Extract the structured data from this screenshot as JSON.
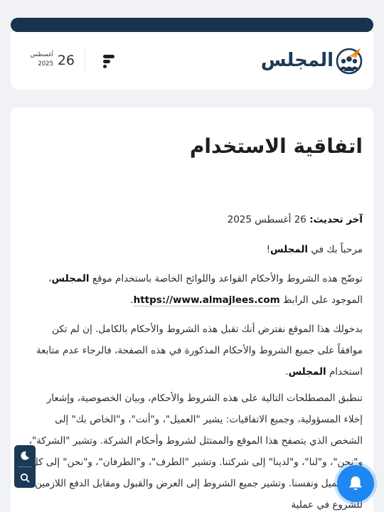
{
  "header": {
    "logo_text": "المجلس",
    "date": {
      "day": "26",
      "month": "أغسطس",
      "year": "2025"
    }
  },
  "article": {
    "title": "اتفاقية الاستخدام",
    "updated_label": "آخر تحديث:",
    "updated_value": "26 أغسطس 2025",
    "welcome_prefix": "مرحباً بك في",
    "welcome_site": "المجلس",
    "welcome_suffix": "!",
    "intro_text": "توضّح هذه الشروط والأحكام القواعد واللوائح الخاصة باستخدام موقع",
    "intro_site": "المجلس",
    "intro_mid": "، الموجود على الرابط",
    "intro_url": "https://www.almajlees.com",
    "intro_end": ".",
    "accept_text": "بدخولك هذا الموقع نفترض أنك تقبل هذه الشروط والأحكام بالكامل. إن لم تكن موافقاً على جميع الشروط والأحكام المذكورة في هذه الصفحة، فالرجاء عدم متابعة استخدام",
    "accept_site": "المجلس",
    "accept_end": ".",
    "terms_text": "تنطبق المصطلحات التالية على هذه الشروط والأحكام، وبيان الخصوصية، وإشعار إخلاء المسؤولية، وجميع الاتفاقيات: يشير \"العميل\"، و\"أنت\"، و\"الخاص بك\" إلى الشخص الذي يتصفح هذا الموقع والممتثل لشروط وأحكام الشركة. وتشير \"الشركة\"، و\"نحن\"، و\"لنا\"، و\"لدينا\" إلى شركتنا. وتشير \"الطرف\"، و\"الطرفان\"، و\"نحن\" إلى كلٍ من العميل ونفسنا. وتشير جميع الشروط إلى العرض والقبول ومقابل الدفع اللازمين للشروع في عملية"
  },
  "icons": {
    "logo": "logo-emblem-icon",
    "menu": "menu-icon",
    "dark_mode": "moon-icon",
    "search": "search-icon",
    "notifications": "bell-icon"
  },
  "colors": {
    "brand_navy": "#1b3a57",
    "accent_orange": "#f29a2e",
    "bell_blue": "#1e88f0",
    "page_bg": "#f1f2f5"
  }
}
